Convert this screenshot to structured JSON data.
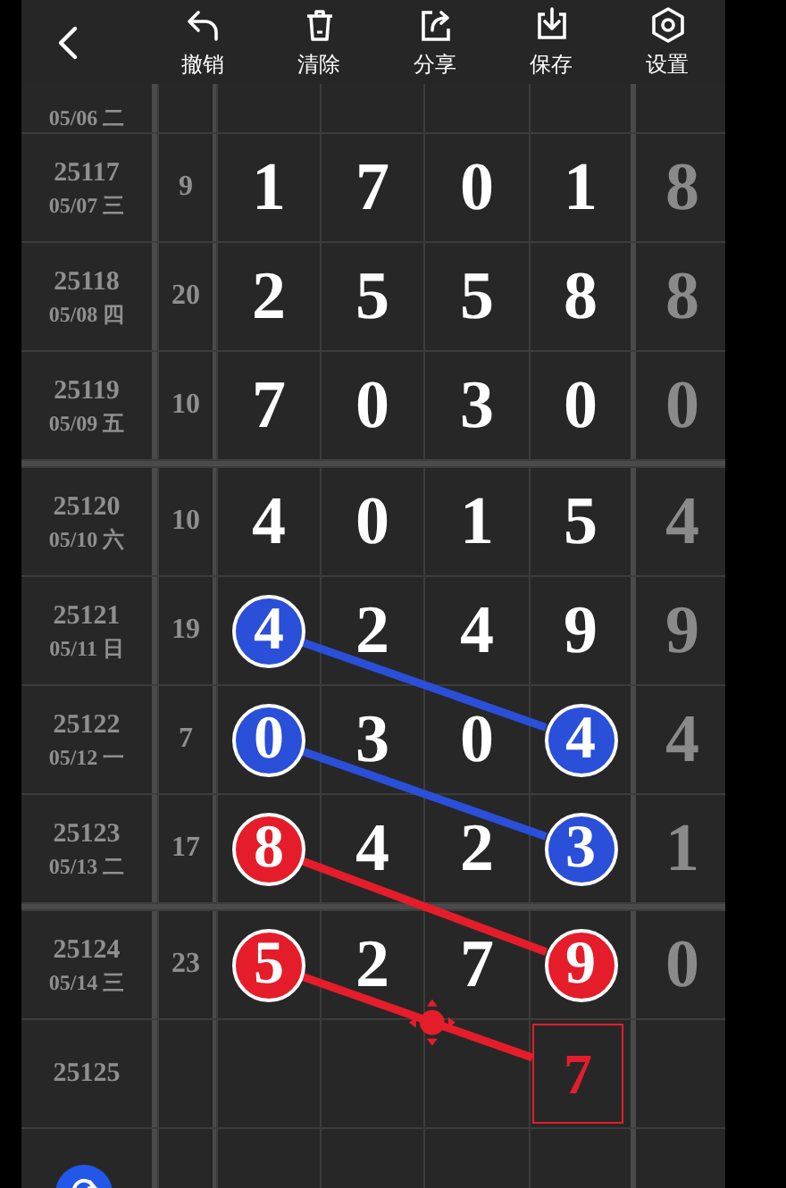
{
  "toolbar": {
    "actions": [
      {
        "kind": "undo",
        "label": "撤销"
      },
      {
        "kind": "clear",
        "label": "清除"
      },
      {
        "kind": "share",
        "label": "分享"
      },
      {
        "kind": "save",
        "label": "保存"
      },
      {
        "kind": "settings",
        "label": "设置"
      }
    ]
  },
  "grid": {
    "partial_top": {
      "date": "05/06 二"
    },
    "rows": [
      {
        "issue": "25117",
        "date": "05/07 三",
        "sum": "9",
        "digits": [
          {
            "kind": "plain",
            "value": "1"
          },
          {
            "kind": "plain",
            "value": "7"
          },
          {
            "kind": "plain",
            "value": "0"
          },
          {
            "kind": "plain",
            "value": "1"
          }
        ],
        "tail": "8"
      },
      {
        "issue": "25118",
        "date": "05/08 四",
        "sum": "20",
        "digits": [
          {
            "kind": "plain",
            "value": "2"
          },
          {
            "kind": "plain",
            "value": "5"
          },
          {
            "kind": "plain",
            "value": "5"
          },
          {
            "kind": "plain",
            "value": "8"
          }
        ],
        "tail": "8"
      },
      {
        "issue": "25119",
        "date": "05/09 五",
        "sum": "10",
        "digits": [
          {
            "kind": "plain",
            "value": "7"
          },
          {
            "kind": "plain",
            "value": "0"
          },
          {
            "kind": "plain",
            "value": "3"
          },
          {
            "kind": "plain",
            "value": "0"
          }
        ],
        "tail": "0",
        "group_end": true
      },
      {
        "issue": "25120",
        "date": "05/10 六",
        "sum": "10",
        "digits": [
          {
            "kind": "plain",
            "value": "4"
          },
          {
            "kind": "plain",
            "value": "0"
          },
          {
            "kind": "plain",
            "value": "1"
          },
          {
            "kind": "plain",
            "value": "5"
          }
        ],
        "tail": "4"
      },
      {
        "issue": "25121",
        "date": "05/11 日",
        "sum": "19",
        "digits": [
          {
            "kind": "ball",
            "value": "4",
            "color": "#2a4fd8",
            "linked": true
          },
          {
            "kind": "plain",
            "value": "2"
          },
          {
            "kind": "plain",
            "value": "4"
          },
          {
            "kind": "plain",
            "value": "9"
          }
        ],
        "tail": "9"
      },
      {
        "issue": "25122",
        "date": "05/12 一",
        "sum": "7",
        "digits": [
          {
            "kind": "ball",
            "value": "0",
            "color": "#2a4fd8",
            "linked": true
          },
          {
            "kind": "plain",
            "value": "3"
          },
          {
            "kind": "plain",
            "value": "0"
          },
          {
            "kind": "ball",
            "value": "4",
            "color": "#2a4fd8"
          }
        ],
        "tail": "4"
      },
      {
        "issue": "25123",
        "date": "05/13 二",
        "sum": "17",
        "digits": [
          {
            "kind": "ball",
            "value": "8",
            "color": "#e51d2a",
            "linked": true
          },
          {
            "kind": "plain",
            "value": "4"
          },
          {
            "kind": "plain",
            "value": "2"
          },
          {
            "kind": "ball",
            "value": "3",
            "color": "#2a4fd8"
          }
        ],
        "tail": "1",
        "group_end": true
      },
      {
        "issue": "25124",
        "date": "05/14 三",
        "sum": "23",
        "digits": [
          {
            "kind": "ball",
            "value": "5",
            "color": "#e51d2a",
            "linked": true,
            "handle": true
          },
          {
            "kind": "plain",
            "value": "2"
          },
          {
            "kind": "plain",
            "value": "7"
          },
          {
            "kind": "ball",
            "value": "9",
            "color": "#e51d2a"
          }
        ],
        "tail": "0"
      },
      {
        "issue": "25125",
        "digits": [
          {
            "kind": "empty"
          },
          {
            "kind": "empty"
          },
          {
            "kind": "empty"
          },
          {
            "kind": "guess",
            "value": "7",
            "color": "#e51d2a"
          }
        ]
      }
    ]
  }
}
